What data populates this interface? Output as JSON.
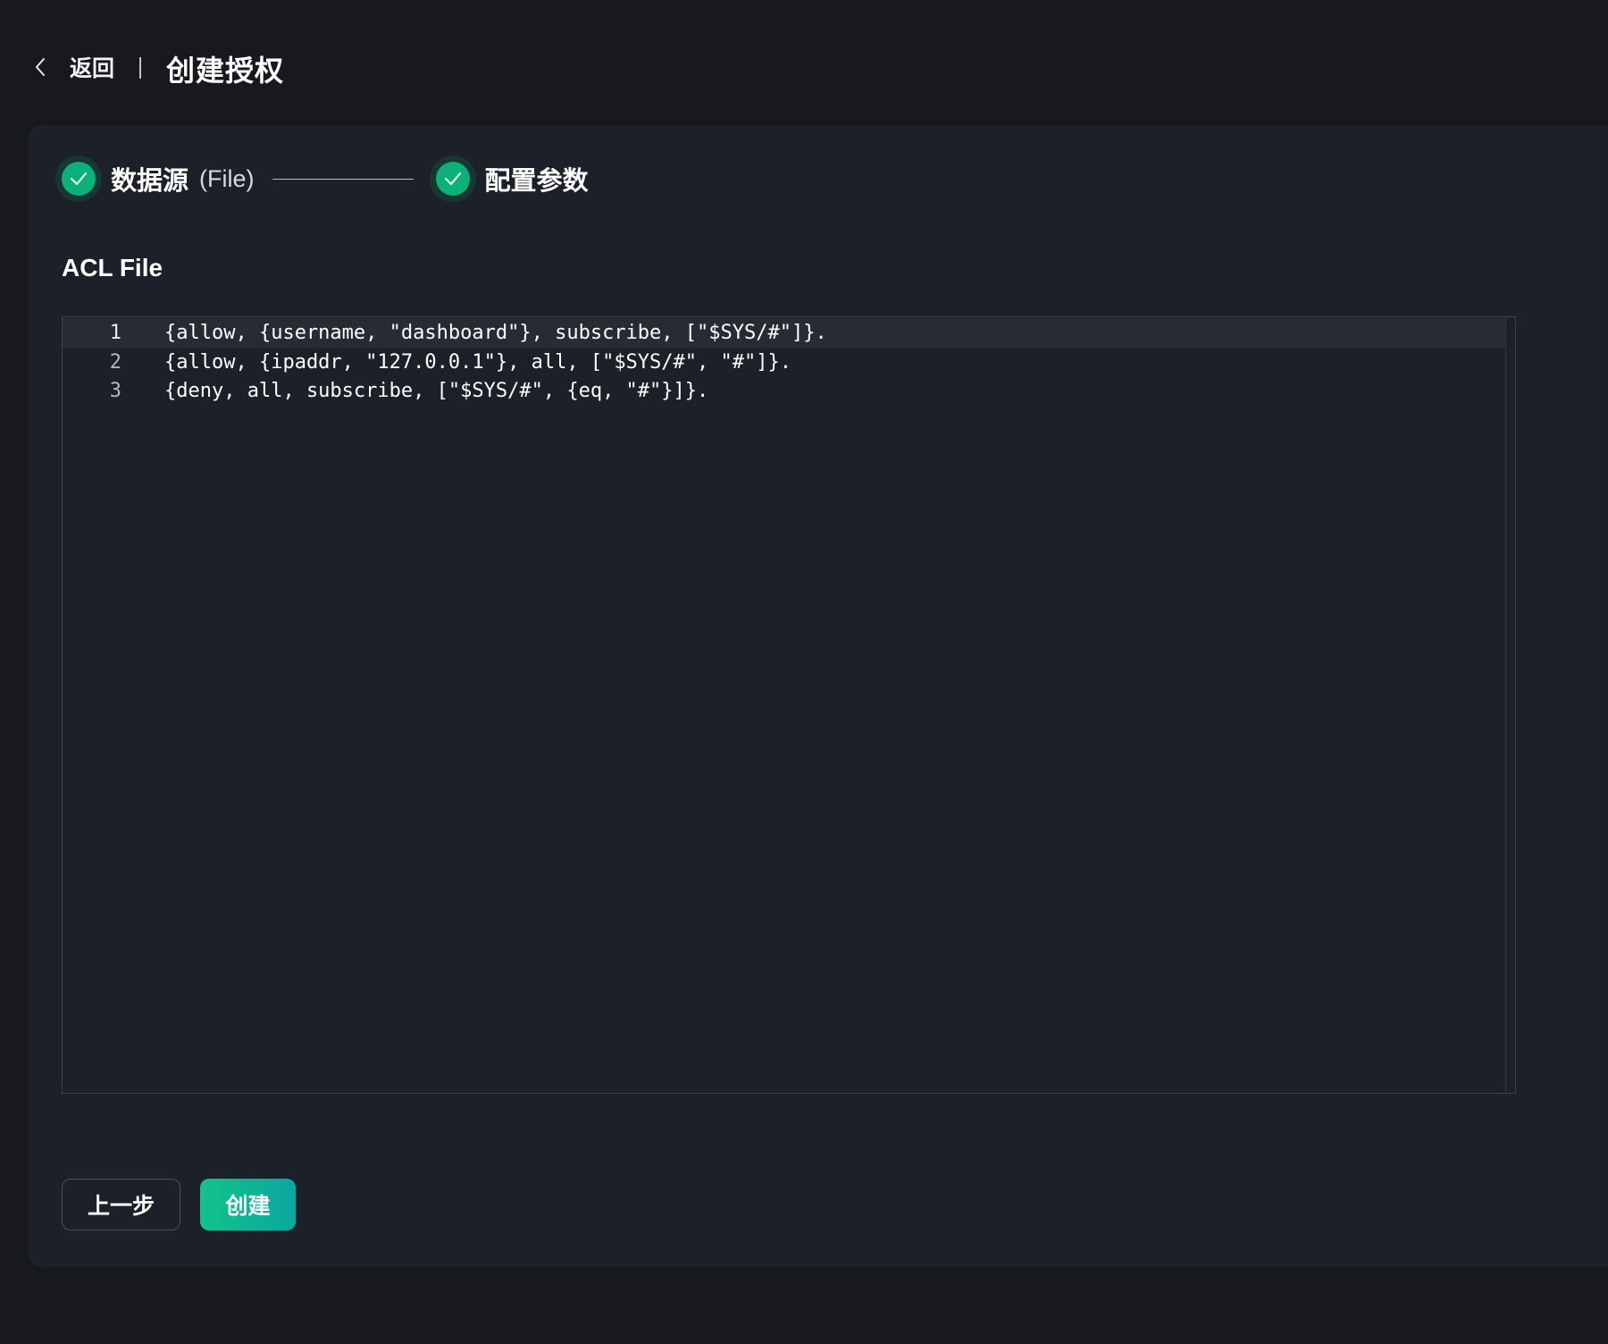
{
  "header": {
    "back_label": "返回",
    "title": "创建授权"
  },
  "steps": [
    {
      "title": "数据源",
      "subtitle": "(File)",
      "status": "finished"
    },
    {
      "title": "配置参数",
      "subtitle": "",
      "status": "finished"
    }
  ],
  "section": {
    "title": "ACL File"
  },
  "editor": {
    "active_line": 1,
    "lines": [
      {
        "number": "1",
        "code": "{allow, {username, \"dashboard\"}, subscribe, [\"$SYS/#\"]}."
      },
      {
        "number": "2",
        "code": "{allow, {ipaddr, \"127.0.0.1\"}, all, [\"$SYS/#\", \"#\"]}."
      },
      {
        "number": "3",
        "code": "{deny, all, subscribe, [\"$SYS/#\", {eq, \"#\"}]}."
      }
    ]
  },
  "actions": {
    "prev_label": "上一步",
    "create_label": "创建"
  },
  "colors": {
    "page_bg": "#17191e",
    "card_bg": "#1c2028",
    "accent": "#0cb179"
  },
  "icons": {
    "back": "chevron-left-icon",
    "step_done": "check-icon"
  }
}
